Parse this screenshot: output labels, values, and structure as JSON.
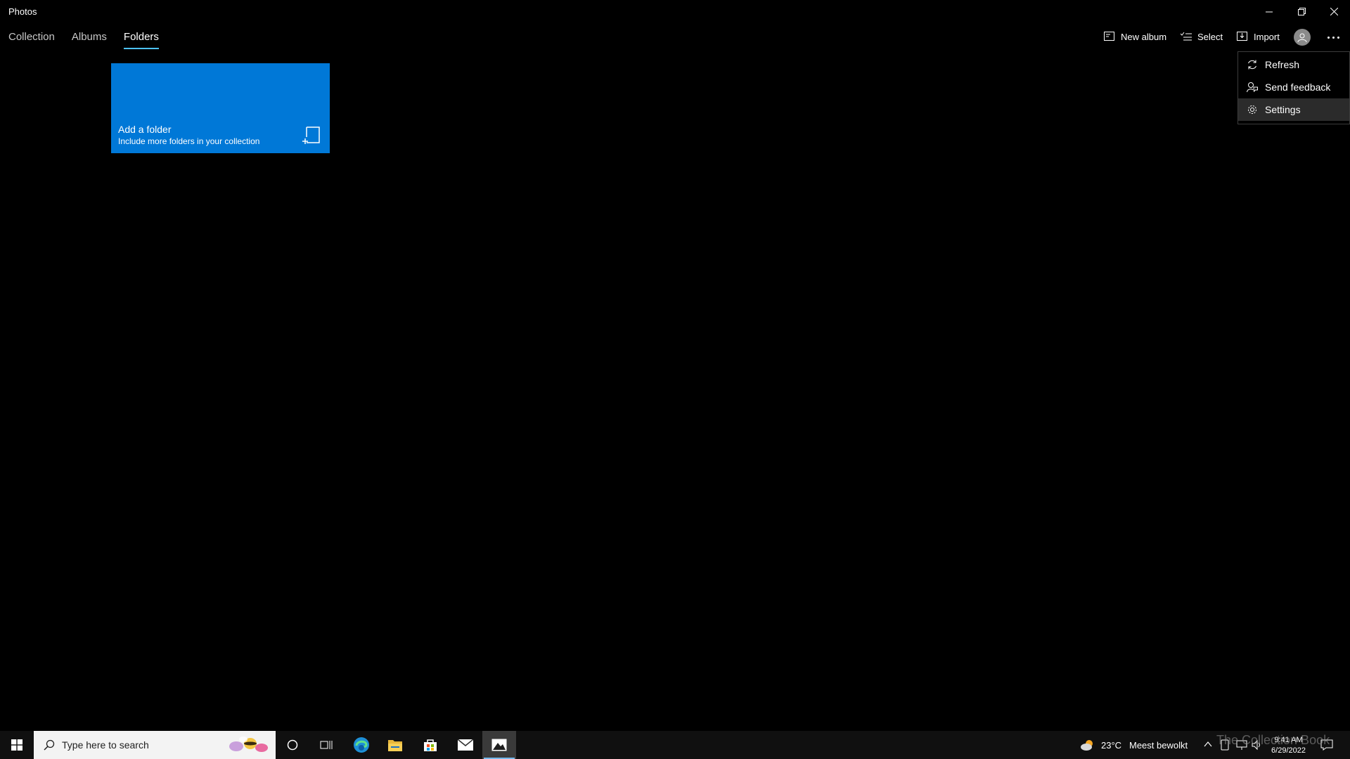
{
  "window": {
    "title": "Photos"
  },
  "tabs": [
    {
      "label": "Collection",
      "active": false
    },
    {
      "label": "Albums",
      "active": false
    },
    {
      "label": "Folders",
      "active": true
    }
  ],
  "commands": {
    "new_album": "New album",
    "select": "Select",
    "import": "Import"
  },
  "menu": {
    "items": [
      {
        "label": "Refresh",
        "icon": "refresh-icon"
      },
      {
        "label": "Send feedback",
        "icon": "feedback-icon"
      },
      {
        "label": "Settings",
        "icon": "gear-icon"
      }
    ]
  },
  "tile": {
    "title": "Add a folder",
    "subtitle": "Include more folders in your collection",
    "color": "#0078d7"
  },
  "taskbar": {
    "search_placeholder": "Type here to search",
    "weather_temp": "23°C",
    "weather_text": "Meest bewolkt",
    "time": "9:41 AM",
    "date": "6/29/2022",
    "watermark": "The Collection Book"
  },
  "colors": {
    "accent": "#0078d7",
    "tab_underline": "#4cc2ff",
    "background": "#000000"
  }
}
